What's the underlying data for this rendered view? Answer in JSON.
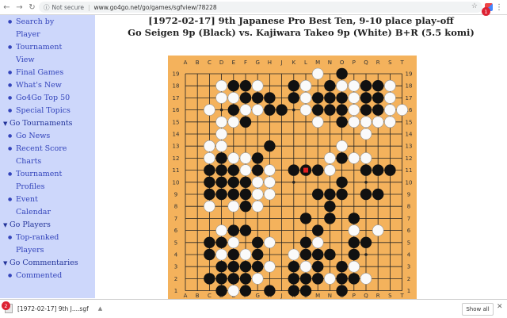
{
  "browser": {
    "security_label": "Not secure",
    "url": "www.go4go.net/go/games/sgfview/78228",
    "extension_badge": "1"
  },
  "sidebar": {
    "items": [
      {
        "kind": "link",
        "label": "Search by"
      },
      {
        "kind": "cont",
        "label": "Player"
      },
      {
        "kind": "link",
        "label": "Tournament"
      },
      {
        "kind": "cont",
        "label": "View"
      },
      {
        "kind": "link",
        "label": "Final Games"
      },
      {
        "kind": "link",
        "label": "What's New"
      },
      {
        "kind": "link",
        "label": "Go4Go Top 50"
      },
      {
        "kind": "link",
        "label": "Special Topics"
      },
      {
        "kind": "head",
        "label": "Go Tournaments"
      },
      {
        "kind": "link",
        "label": "Go News"
      },
      {
        "kind": "link",
        "label": "Recent Score"
      },
      {
        "kind": "cont",
        "label": "Charts"
      },
      {
        "kind": "link",
        "label": "Tournament"
      },
      {
        "kind": "cont",
        "label": "Profiles"
      },
      {
        "kind": "link",
        "label": "Event"
      },
      {
        "kind": "cont",
        "label": "Calendar"
      },
      {
        "kind": "head",
        "label": "Go Players"
      },
      {
        "kind": "link",
        "label": "Top-ranked"
      },
      {
        "kind": "cont",
        "label": "Players"
      },
      {
        "kind": "head",
        "label": "Go Commentaries"
      },
      {
        "kind": "link",
        "label": "Commented"
      }
    ]
  },
  "page": {
    "title_line1": "[1972-02-17] 9th Japanese Pro Best Ten, 9-10 place play-off",
    "title_line2": "Go Seigen 9p (Black) vs. Kajiwara Takeo 9p (White) B+R (5.5 komi)"
  },
  "board": {
    "columns": [
      "A",
      "B",
      "C",
      "D",
      "E",
      "F",
      "G",
      "H",
      "J",
      "K",
      "L",
      "M",
      "N",
      "O",
      "P",
      "Q",
      "R",
      "S",
      "T"
    ],
    "rows": [
      "19",
      "18",
      "17",
      "16",
      "15",
      "14",
      "13",
      "12",
      "11",
      "10",
      "9",
      "8",
      "7",
      "6",
      "5",
      "4",
      "3",
      "2",
      "1"
    ],
    "grid_rows": [
      "...........w.b.....",
      "...wbbw..bw.bwwbbw.",
      "...wwbbb.bwbbbwbbw.",
      "..w.bwwbb.wbbbwbbww",
      "...wwb.....w.bwwww.",
      "...w...........w...",
      "..ww...b.....w.....",
      "..wbwwb.....wbww...",
      "..bbbwbw.bbbw..bbb.",
      "..bbbbww.....b.....",
      "..bbbbww...bbb.bb..",
      "..w.wbw.....b......",
      "..........b.b.b....",
      "...wbb.....b..w.w..",
      "..bbw.bw..bw..bb...",
      "..bwbwb..wbbb.b....",
      "...bbbbw.bwb.bw....",
      "..bbbbw..bbbwbbw...",
      "...bwb.b.bb..b....."
    ],
    "star_points": [
      "D16",
      "K16",
      "Q16",
      "D10",
      "K10",
      "Q10",
      "D4",
      "K4",
      "Q4"
    ],
    "last_move": "L11",
    "last_move_color": "#e02020",
    "board_color": "#f4b25c"
  },
  "downloads": {
    "file_label": "[1972-02-17] 9th J....sgf",
    "badge": "2",
    "show_all": "Show all"
  }
}
